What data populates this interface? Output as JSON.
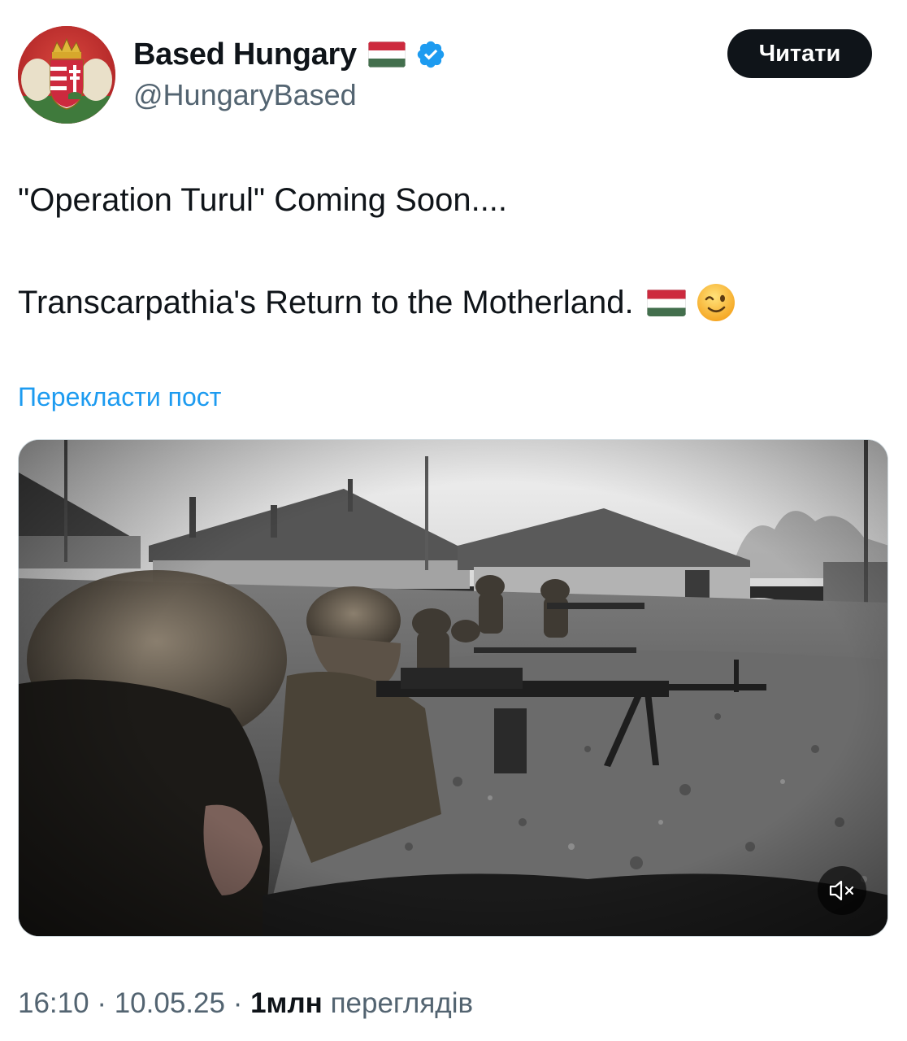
{
  "author": {
    "display_name": "Based Hungary",
    "handle": "@HungaryBased",
    "verified": true,
    "avatar_icon": "hungarian-coat-of-arms-icon"
  },
  "follow_button_label": "Читати",
  "tweet": {
    "line1": "\"Operation Turul\" Coming Soon....",
    "line2": "Transcarpathia's Return to the Motherland."
  },
  "translate_label": "Перекласти пост",
  "media": {
    "type": "video",
    "muted": true,
    "mute_icon": "speaker-muted-icon"
  },
  "meta": {
    "time": "16:10",
    "separator": "·",
    "date": "10.05.25",
    "views_count": "1млн",
    "views_label": "переглядів"
  },
  "colors": {
    "text": "#0f1419",
    "secondary": "#536471",
    "link": "#1d9bf0",
    "verified": "#1d9bf0",
    "flag_red": "#cd2a3e",
    "flag_white": "#ffffff",
    "flag_green": "#436f4d"
  }
}
